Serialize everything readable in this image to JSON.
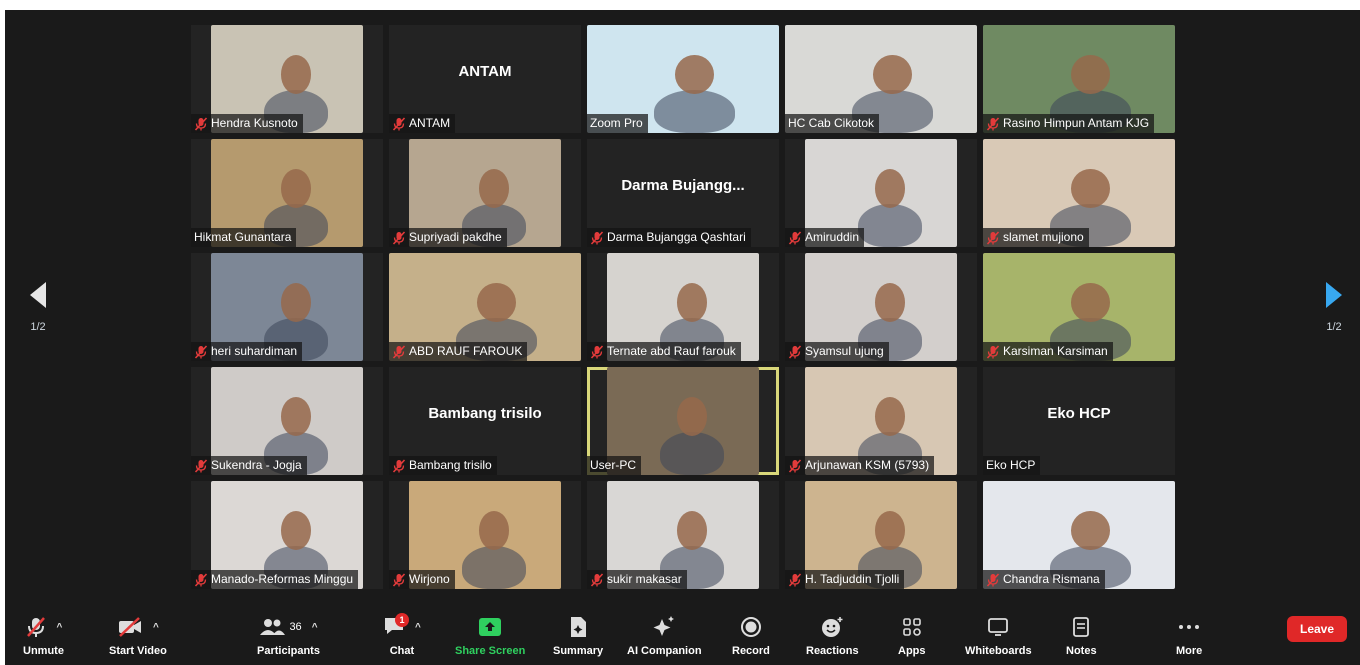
{
  "pager": {
    "left_page": "1/2",
    "right_page": "1/2"
  },
  "tiles": [
    {
      "name": "Hendra Kusnoto",
      "muted": true,
      "mode": "video",
      "bg": "#c9c3b4"
    },
    {
      "name": "ANTAM",
      "muted": true,
      "mode": "name",
      "big": "ANTAM"
    },
    {
      "name": "Zoom Pro",
      "muted": false,
      "mode": "video",
      "bg": "#cfe5ef"
    },
    {
      "name": "HC Cab Cikotok",
      "muted": false,
      "mode": "video",
      "bg": "#d9d9d6"
    },
    {
      "name": "Rasino Himpun Antam KJG",
      "muted": true,
      "mode": "video",
      "bg": "#6f8a62"
    },
    {
      "name": "Hikmat Gunantara",
      "muted": false,
      "mode": "video",
      "bg": "#b59a6e"
    },
    {
      "name": "Supriyadi pakdhe",
      "muted": true,
      "mode": "video",
      "bg": "#b6a690"
    },
    {
      "name": "Darma Bujangga Qashtari",
      "muted": true,
      "mode": "name",
      "big": "Darma  Bujangg..."
    },
    {
      "name": "Amiruddin",
      "muted": true,
      "mode": "video",
      "bg": "#d8d6d4"
    },
    {
      "name": "slamet mujiono",
      "muted": true,
      "mode": "video",
      "bg": "#d9c9b6"
    },
    {
      "name": "heri suhardiman",
      "muted": true,
      "mode": "video",
      "bg": "#7d8796"
    },
    {
      "name": "ABD RAUF FAROUK",
      "muted": true,
      "mode": "video",
      "bg": "#c5b08a"
    },
    {
      "name": "Ternate abd Rauf farouk",
      "muted": true,
      "mode": "video",
      "bg": "#d6d3cf"
    },
    {
      "name": "Syamsul ujung",
      "muted": true,
      "mode": "video",
      "bg": "#d3cfcc"
    },
    {
      "name": "Karsiman Karsiman",
      "muted": true,
      "mode": "video",
      "bg": "#a7b46a"
    },
    {
      "name": "Sukendra - Jogja",
      "muted": true,
      "mode": "video",
      "bg": "#cfcbc8"
    },
    {
      "name": "Bambang trisilo",
      "muted": true,
      "mode": "name",
      "big": "Bambang trisilo"
    },
    {
      "name": "User-PC",
      "muted": false,
      "mode": "video",
      "bg": "#7a6a55",
      "active": true
    },
    {
      "name": "Arjunawan KSM (5793)",
      "muted": true,
      "mode": "video",
      "bg": "#d7c7b3"
    },
    {
      "name": "Eko HCP",
      "muted": false,
      "mode": "name",
      "big": "Eko HCP"
    },
    {
      "name": "Manado-Reformas Minggu",
      "muted": true,
      "mode": "video",
      "bg": "#dcd8d5"
    },
    {
      "name": "Wirjono",
      "muted": true,
      "mode": "video",
      "bg": "#c9a97a"
    },
    {
      "name": "sukir makasar",
      "muted": true,
      "mode": "video",
      "bg": "#d9d7d5"
    },
    {
      "name": "H. Tadjuddin Tjolli",
      "muted": true,
      "mode": "video",
      "bg": "#cdb48f"
    },
    {
      "name": "Chandra Rismana",
      "muted": true,
      "mode": "video",
      "bg": "#e4e7ec"
    }
  ],
  "toolbar": {
    "unmute": "Unmute",
    "start_video": "Start Video",
    "participants": "Participants",
    "participants_count": "36",
    "chat": "Chat",
    "chat_badge": "1",
    "share_screen": "Share Screen",
    "summary": "Summary",
    "ai_companion": "AI Companion",
    "record": "Record",
    "reactions": "Reactions",
    "apps": "Apps",
    "whiteboards": "Whiteboards",
    "notes": "Notes",
    "more": "More",
    "leave": "Leave"
  },
  "colors": {
    "accent_green": "#2fd05f",
    "leave_red": "#e02828",
    "active_speaker": "#d9d77a",
    "muted_red": "#e23b3b"
  }
}
